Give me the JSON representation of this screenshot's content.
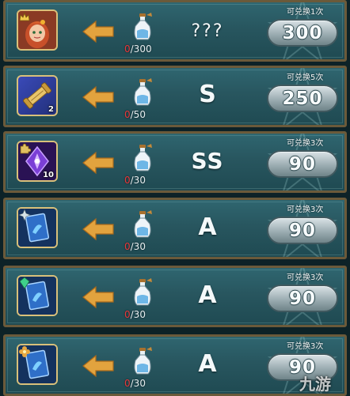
{
  "colors": {
    "panel": "#28565f",
    "frame": "#6b5a3a",
    "progress_current": "#e8373a",
    "arrow": "#e2a33e"
  },
  "rows": [
    {
      "item_icon": "hero-portrait-icon",
      "item_qty": "",
      "badge_icon": "crown-badge-icon",
      "progress_current": "0",
      "progress_total": "/300",
      "grade": "???",
      "exchange_label": "可兑换1次",
      "cost": "300"
    },
    {
      "item_icon": "scroll-icon",
      "item_qty": "2",
      "badge_icon": "",
      "progress_current": "0",
      "progress_total": "/50",
      "grade": "S",
      "exchange_label": "可兑换5次",
      "cost": "250"
    },
    {
      "item_icon": "rune-card-icon",
      "item_qty": "10",
      "badge_icon": "puzzle-badge-icon",
      "progress_current": "0",
      "progress_total": "/30",
      "grade": "SS",
      "exchange_label": "可兑换3次",
      "cost": "90"
    },
    {
      "item_icon": "blue-card-icon",
      "item_qty": "",
      "badge_icon": "spark-badge-icon",
      "progress_current": "0",
      "progress_total": "/30",
      "grade": "A",
      "exchange_label": "可兑换3次",
      "cost": "90"
    },
    {
      "item_icon": "blue-card-icon",
      "item_qty": "",
      "badge_icon": "gem-badge-icon",
      "progress_current": "0",
      "progress_total": "/30",
      "grade": "A",
      "exchange_label": "可兑换3次",
      "cost": "90"
    },
    {
      "item_icon": "blue-card-icon",
      "item_qty": "",
      "badge_icon": "flower-badge-icon",
      "progress_current": "0",
      "progress_total": "/30",
      "grade": "A",
      "exchange_label": "可兑换3次",
      "cost": "90"
    }
  ],
  "watermark": "九游"
}
